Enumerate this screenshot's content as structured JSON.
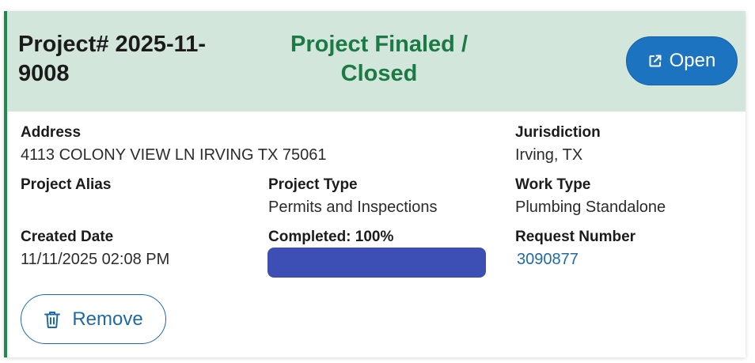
{
  "colors": {
    "accent": "#1e8a4c",
    "header_bg": "#d3e6dc",
    "status_text": "#1c7a45",
    "open_button_bg": "#1c73c0",
    "link": "#1f6aa5",
    "progress_fill": "#3d4fb4"
  },
  "project": {
    "number": "Project# 2025-11-9008",
    "status": "Project Finaled / Closed"
  },
  "open_button": {
    "icon": "external-link-icon",
    "label": "Open"
  },
  "fields": {
    "address": {
      "label": "Address",
      "value": "4113 COLONY VIEW LN IRVING TX 75061"
    },
    "jurisdiction": {
      "label": "Jurisdiction",
      "value": "Irving, TX"
    },
    "project_alias": {
      "label": "Project Alias",
      "value": ""
    },
    "project_type": {
      "label": "Project Type",
      "value": "Permits and Inspections"
    },
    "work_type": {
      "label": "Work Type",
      "value": "Plumbing Standalone"
    },
    "created_date": {
      "label": "Created Date",
      "value": "11/11/2025 02:08 PM"
    },
    "completed": {
      "label": "Completed: 100%",
      "percent": 100
    },
    "request_number": {
      "label": "Request Number",
      "value": "3090877"
    }
  },
  "remove_button": {
    "icon": "trash-icon",
    "label": "Remove"
  }
}
